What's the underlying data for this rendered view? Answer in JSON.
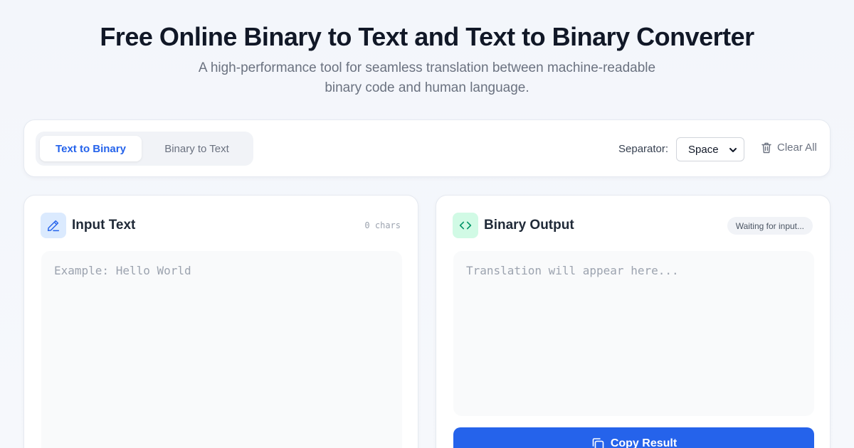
{
  "header": {
    "title": "Free Online Binary to Text and Text to Binary Converter",
    "subtitle": "A high-performance tool for seamless translation between machine-readable binary code and human language."
  },
  "toolbar": {
    "tabs": [
      {
        "label": "Text to Binary",
        "active": true
      },
      {
        "label": "Binary to Text",
        "active": false
      }
    ],
    "separator_label": "Separator:",
    "separator_value": "Space",
    "clear_label": "Clear All"
  },
  "input_panel": {
    "title": "Input Text",
    "char_count": "0 chars",
    "placeholder": "Example: Hello World",
    "icon": "pencil-icon"
  },
  "output_panel": {
    "title": "Binary Output",
    "status": "Waiting for input...",
    "placeholder": "Translation will appear here...",
    "icon": "code-icon",
    "copy_label": "Copy Result"
  },
  "colors": {
    "accent": "#2563eb",
    "green": "#10b981"
  }
}
